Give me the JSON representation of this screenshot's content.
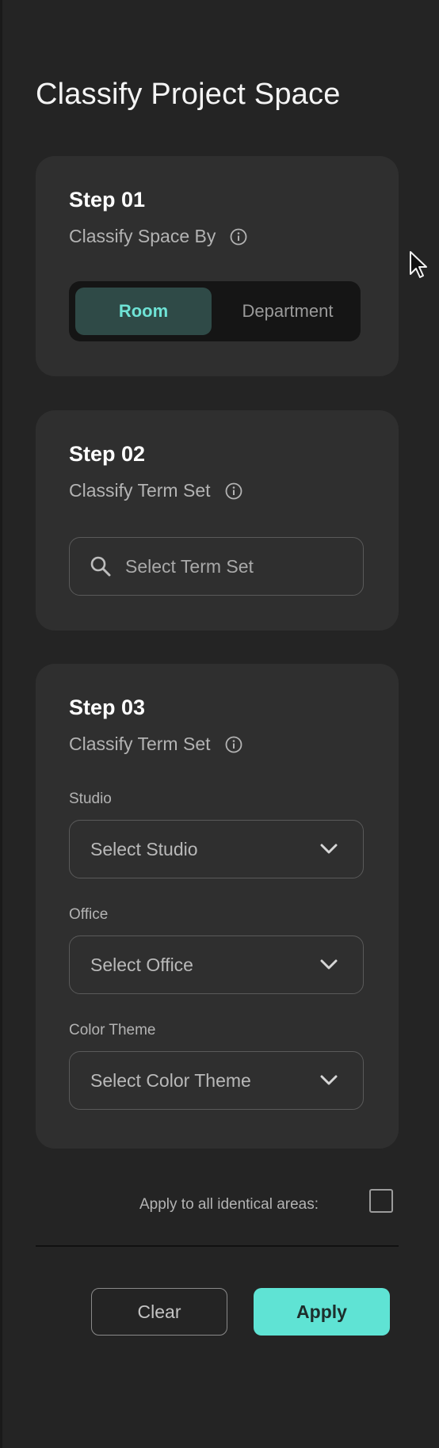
{
  "title": "Classify Project Space",
  "step1": {
    "title": "Step 01",
    "subtitle": "Classify Space By",
    "options": [
      "Room",
      "Department"
    ],
    "selected": "Room"
  },
  "step2": {
    "title": "Step 02",
    "subtitle": "Classify Term Set",
    "search_placeholder": "Select Term Set"
  },
  "step3": {
    "title": "Step 03",
    "subtitle": "Classify Term Set",
    "fields": [
      {
        "label": "Studio",
        "value": "Select Studio"
      },
      {
        "label": "Office",
        "value": "Select Office"
      },
      {
        "label": "Color Theme",
        "value": "Select Color Theme"
      }
    ]
  },
  "apply_all_label": "Apply to all identical areas:",
  "apply_all_checked": false,
  "buttons": {
    "clear": "Clear",
    "apply": "Apply"
  },
  "colors": {
    "background": "#242424",
    "card": "#2f2f2f",
    "accent": "#5fe3d4",
    "active_segment": "#2f4a47",
    "active_text": "#6fe3d6"
  },
  "icons": {
    "info": "info-icon",
    "search": "search-icon",
    "chevron": "chevron-down-icon",
    "cursor": "mouse-cursor-icon"
  }
}
